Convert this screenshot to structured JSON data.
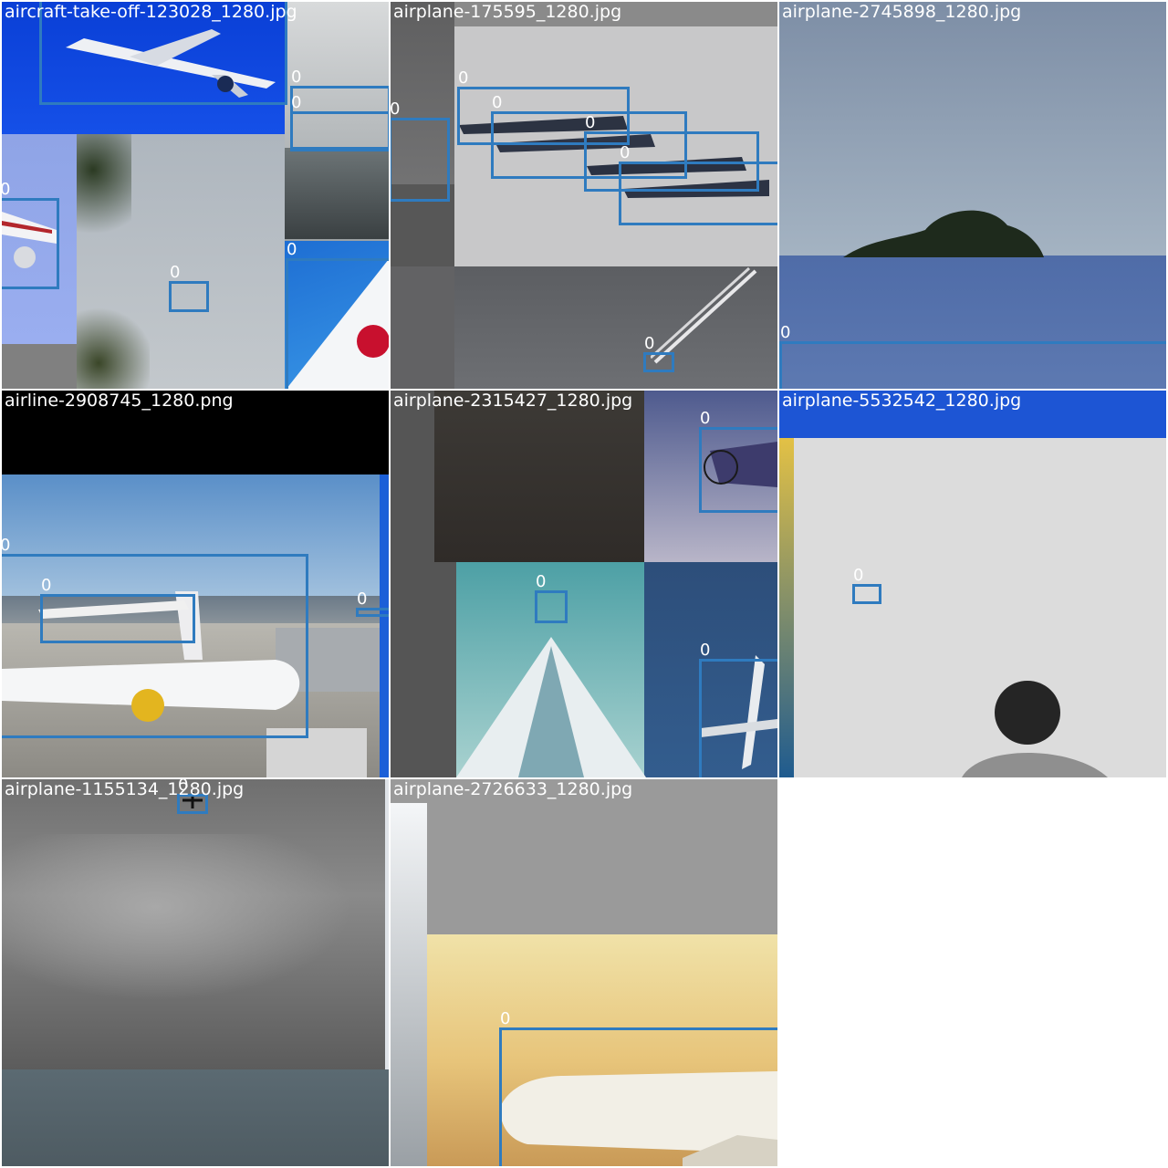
{
  "grid": {
    "class_label": "0",
    "box_color": "#2f7bbf",
    "tiles": [
      {
        "filename": "aircraft-take-off-123028_1280.jpg"
      },
      {
        "filename": "airplane-175595_1280.jpg"
      },
      {
        "filename": "airplane-2745898_1280.jpg"
      },
      {
        "filename": "airline-2908745_1280.png"
      },
      {
        "filename": "airplane-2315427_1280.jpg"
      },
      {
        "filename": "airplane-5532542_1280.jpg"
      },
      {
        "filename": "airplane-1155134_1280.jpg"
      },
      {
        "filename": "airplane-2726633_1280.jpg"
      }
    ]
  }
}
